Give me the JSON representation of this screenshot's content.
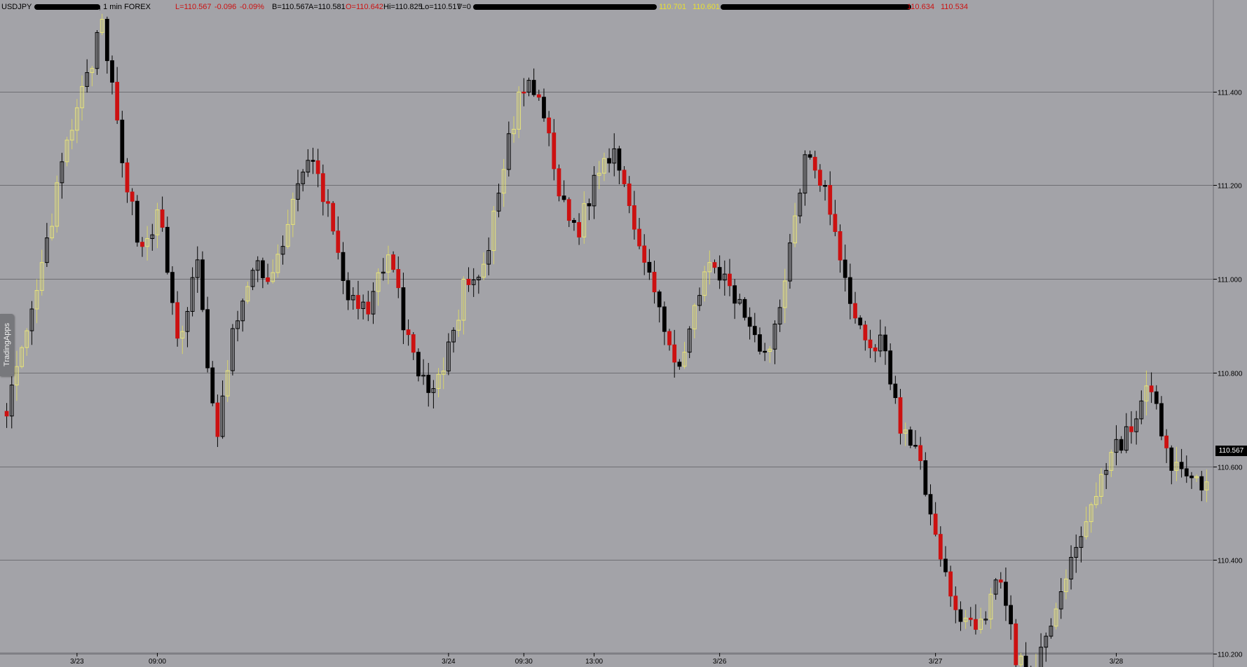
{
  "header": {
    "symbol": "USDJPY -",
    "interval": ", 1 min  FOREX",
    "last": "L=110.567",
    "change": "-0.096",
    "change_pct": "-0.09%",
    "bid": "B=110.567",
    "ask": "A=110.581",
    "open": "O=110.642",
    "high": "Hi=110.825",
    "low": "Lo=110.517",
    "volume": "V=0",
    "study1_a": "110.701",
    "study1_b": "110.601",
    "study2_a": "110.634",
    "study2_b": "110.534"
  },
  "side_tab": {
    "label": "TradingApps"
  },
  "price_axis": {
    "current_price_label": "110.567"
  },
  "colors": {
    "background": "#a3a3a8",
    "candle_up": "#e8e47a",
    "candle_down": "#cc1111",
    "candle_neutral": "#000000",
    "grid": "#6e6e73",
    "header_red": "#cc1111",
    "header_yellow": "#e8e030"
  },
  "chart_data": {
    "type": "candlestick",
    "symbol": "USDJPY",
    "ylim": [
      110.1,
      111.6
    ],
    "y_ticks": [
      111.4,
      111.2,
      111.0,
      110.8,
      110.6,
      110.4,
      110.2
    ],
    "y_tick_labels": [
      "111.400",
      "111.200",
      "111.000",
      "110.800",
      "110.600",
      "110.400",
      "110.200"
    ],
    "x_tick_labels": [
      "3/23",
      "09:00",
      "3/24",
      "09:30",
      "13:00",
      "3/26",
      "3/27",
      "3/28"
    ],
    "x_tick_index": [
      14,
      30,
      88,
      103,
      117,
      142,
      185,
      221
    ],
    "grid": true,
    "close_path": [
      110.73,
      110.86,
      111.05,
      111.26,
      111.4,
      111.54,
      111.28,
      111.06,
      111.14,
      110.86,
      111.03,
      110.65,
      110.91,
      111.02,
      111.01,
      111.16,
      111.26,
      111.13,
      110.95,
      110.92,
      111.07,
      110.88,
      110.76,
      110.81,
      110.98,
      111.0,
      111.22,
      111.41,
      111.39,
      111.18,
      111.1,
      111.23,
      111.28,
      111.11,
      110.99,
      110.8,
      110.91,
      111.04,
      110.97,
      110.91,
      110.83,
      111.04,
      111.29,
      111.19,
      110.99,
      110.87,
      110.86,
      110.67,
      110.61,
      110.39,
      110.29,
      110.24,
      110.38,
      110.19,
      110.15,
      110.29,
      110.41,
      110.53,
      110.63,
      110.68,
      110.77,
      110.62,
      110.56,
      110.57
    ],
    "last_price": 110.567
  }
}
